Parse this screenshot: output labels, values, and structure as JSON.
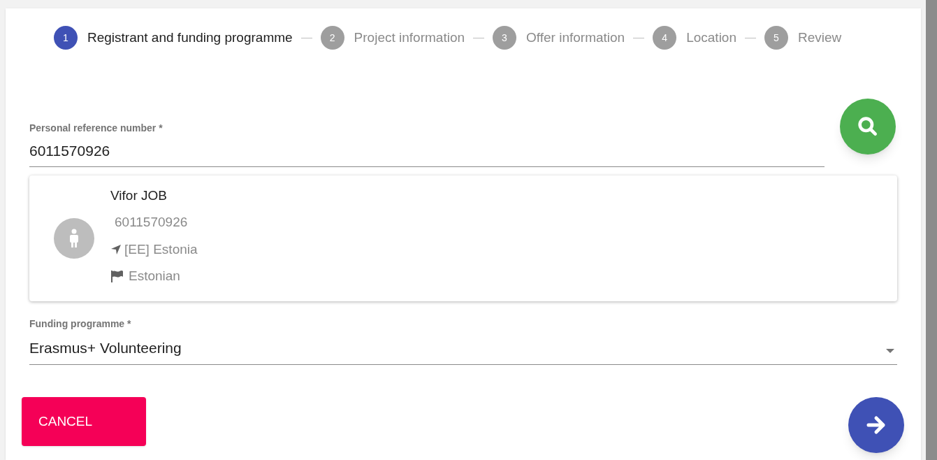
{
  "steps": [
    {
      "number": "1",
      "label": "Registrant and funding programme",
      "selected": true
    },
    {
      "number": "2",
      "label": "Project information",
      "selected": false
    },
    {
      "number": "3",
      "label": "Offer information",
      "selected": false
    },
    {
      "number": "4",
      "label": "Location",
      "selected": false
    },
    {
      "number": "5",
      "label": "Review",
      "selected": false
    }
  ],
  "reference_field": {
    "label": "Personal reference number *",
    "value": "6011570926"
  },
  "person_card": {
    "name": "Vifor JOB",
    "number": "6011570926",
    "country": "[EE] Estonia",
    "language": "Estonian"
  },
  "funding_field": {
    "label": "Funding programme *",
    "value": "Erasmus+ Volunteering"
  },
  "buttons": {
    "cancel": "CANCEL"
  }
}
